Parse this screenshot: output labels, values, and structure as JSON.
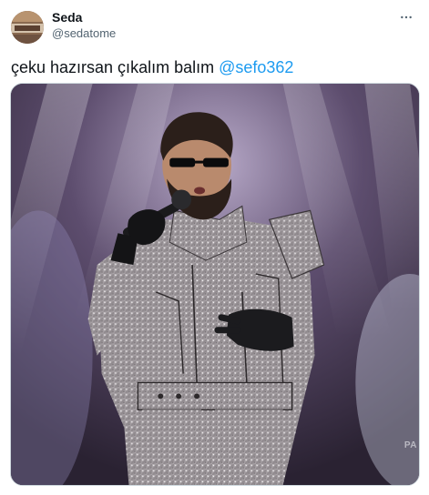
{
  "tweet": {
    "author": {
      "display_name": "Seda",
      "handle": "@sedatome",
      "avatar_icon": "avatar-photo"
    },
    "more_icon": "more-horizontal-icon",
    "text_prefix": "çeku hazırsan çıkalım balım ",
    "mention": "@sefo362",
    "media": {
      "watermark": "PA"
    }
  },
  "colors": {
    "text_primary": "#0f1419",
    "text_secondary": "#536471",
    "link": "#1d9bf0",
    "border": "#cfd9de"
  }
}
